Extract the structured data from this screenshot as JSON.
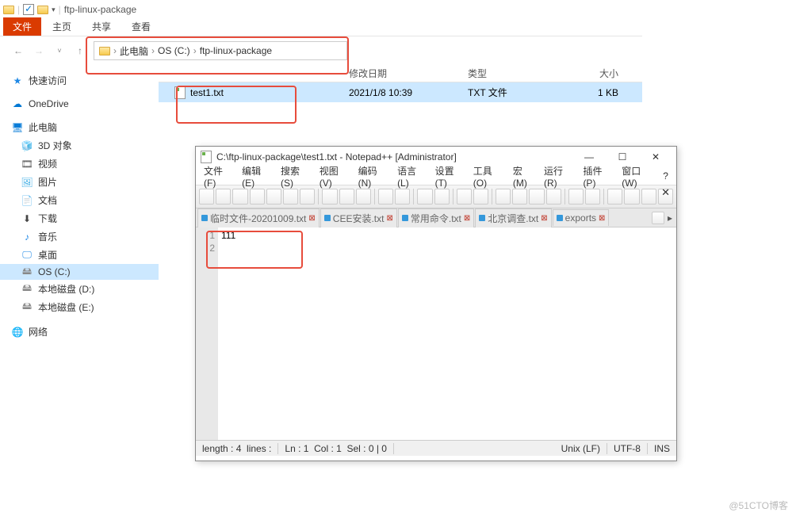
{
  "explorer": {
    "title_text": "ftp-linux-package",
    "ribbon_tabs": {
      "file": "文件",
      "home": "主页",
      "share": "共享",
      "view": "查看"
    },
    "breadcrumb": {
      "root": "此电脑",
      "drive": "OS (C:)",
      "folder": "ftp-linux-package"
    },
    "columns": {
      "date": "修改日期",
      "type": "类型",
      "size": "大小"
    },
    "row": {
      "name": "test1.txt",
      "date": "2021/1/8 10:39",
      "type": "TXT 文件",
      "size": "1 KB"
    },
    "sidebar": {
      "quick": "快速访问",
      "onedrive": "OneDrive",
      "pc": "此电脑",
      "obj3d": "3D 对象",
      "video": "视频",
      "pictures": "图片",
      "docs": "文档",
      "downloads": "下载",
      "music": "音乐",
      "desktop": "桌面",
      "osc": "OS (C:)",
      "d": "本地磁盘 (D:)",
      "e": "本地磁盘 (E:)",
      "network": "网络"
    }
  },
  "notepad": {
    "title": "C:\\ftp-linux-package\\test1.txt - Notepad++ [Administrator]",
    "menu": {
      "file": "文件(F)",
      "edit": "编辑(E)",
      "search": "搜索(S)",
      "view": "视图(V)",
      "encoding": "编码(N)",
      "lang": "语言(L)",
      "settings": "设置(T)",
      "tools": "工具(O)",
      "macro": "宏(M)",
      "run": "运行(R)",
      "plugins": "插件(P)",
      "window": "窗口(W)",
      "help": "?"
    },
    "tabs": [
      "临时文件-20201009.txt",
      "CEE安装.txt",
      "常用命令.txt",
      "北京调查.txt",
      "exports"
    ],
    "lines": [
      "111",
      ""
    ],
    "status": {
      "length": "length : 4",
      "lines": "lines : ",
      "ln": "Ln : 1",
      "col": "Col : 1",
      "sel": "Sel : 0 | 0",
      "eol": "Unix (LF)",
      "enc": "UTF-8",
      "ins": "INS"
    }
  },
  "watermark": "@51CTO博客"
}
